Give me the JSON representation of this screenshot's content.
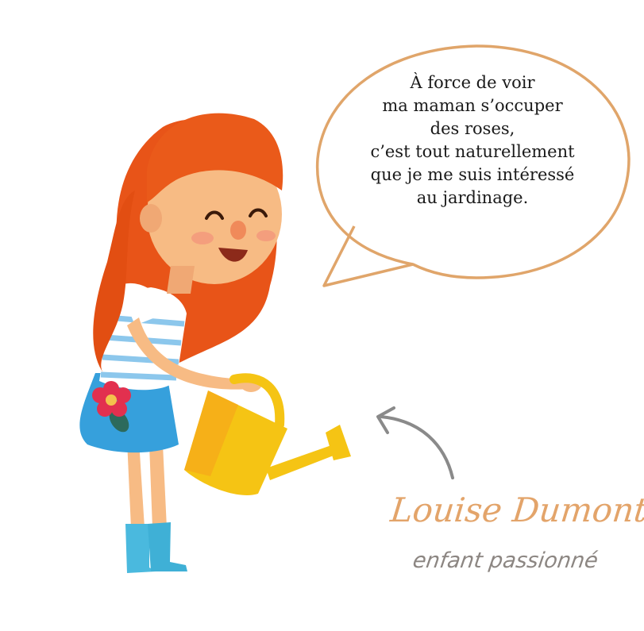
{
  "speech_bubble": {
    "lines": [
      "À force de voir",
      "ma maman s’occuper",
      "des roses,",
      "c’est tout naturellement",
      "que je me suis intéressé",
      "au jardinage."
    ]
  },
  "signature": {
    "name": "Louise Dumont,",
    "role": "enfant passionné"
  },
  "illustration": {
    "subject_icon": "girl-watering-can-icon",
    "pointer_icon": "curved-arrow-icon"
  },
  "colors": {
    "background": "#ffffff",
    "bubble_border": "#e0a56a",
    "hair": "#ea5a1a",
    "skin": "#f7bb84",
    "shirt_stripe": "#8cc7ec",
    "skirt": "#36a0dc",
    "boots": "#4ab9de",
    "watering_can": "#f5c414",
    "flower": "#e2304f",
    "arrow": "#8a8a8a",
    "signature_name": "#e3a46a",
    "signature_role": "#8c8682",
    "text": "#1a1a1a"
  }
}
